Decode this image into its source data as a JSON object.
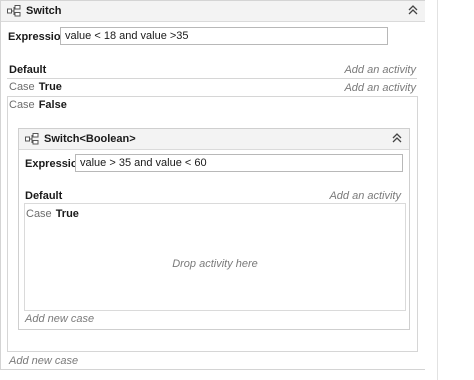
{
  "outer_switch": {
    "title": "Switch",
    "expression_label": "Expression",
    "expression_value": "value < 18 and  value >35",
    "default_label": "Default",
    "add_activity": "Add an activity",
    "cases": [
      {
        "keyword": "Case",
        "value": "True",
        "action": "Add an activity"
      },
      {
        "keyword": "Case",
        "value": "False"
      }
    ],
    "add_new_case": "Add new case"
  },
  "inner_switch": {
    "title": "Switch<Boolean>",
    "expression_label": "Expression",
    "expression_value": "value > 35 and value < 60",
    "default_label": "Default",
    "add_activity": "Add an activity",
    "cases": [
      {
        "keyword": "Case",
        "value": "True",
        "drop_hint": "Drop activity here"
      }
    ],
    "add_new_case": "Add new case"
  },
  "icons": {
    "switch": "switch-activity-icon",
    "collapse": "double-chevron-up-icon"
  },
  "colors": {
    "title_bar": "#f3f3f3",
    "border": "#d4d4d4",
    "hint_text": "#7a7a7a"
  }
}
